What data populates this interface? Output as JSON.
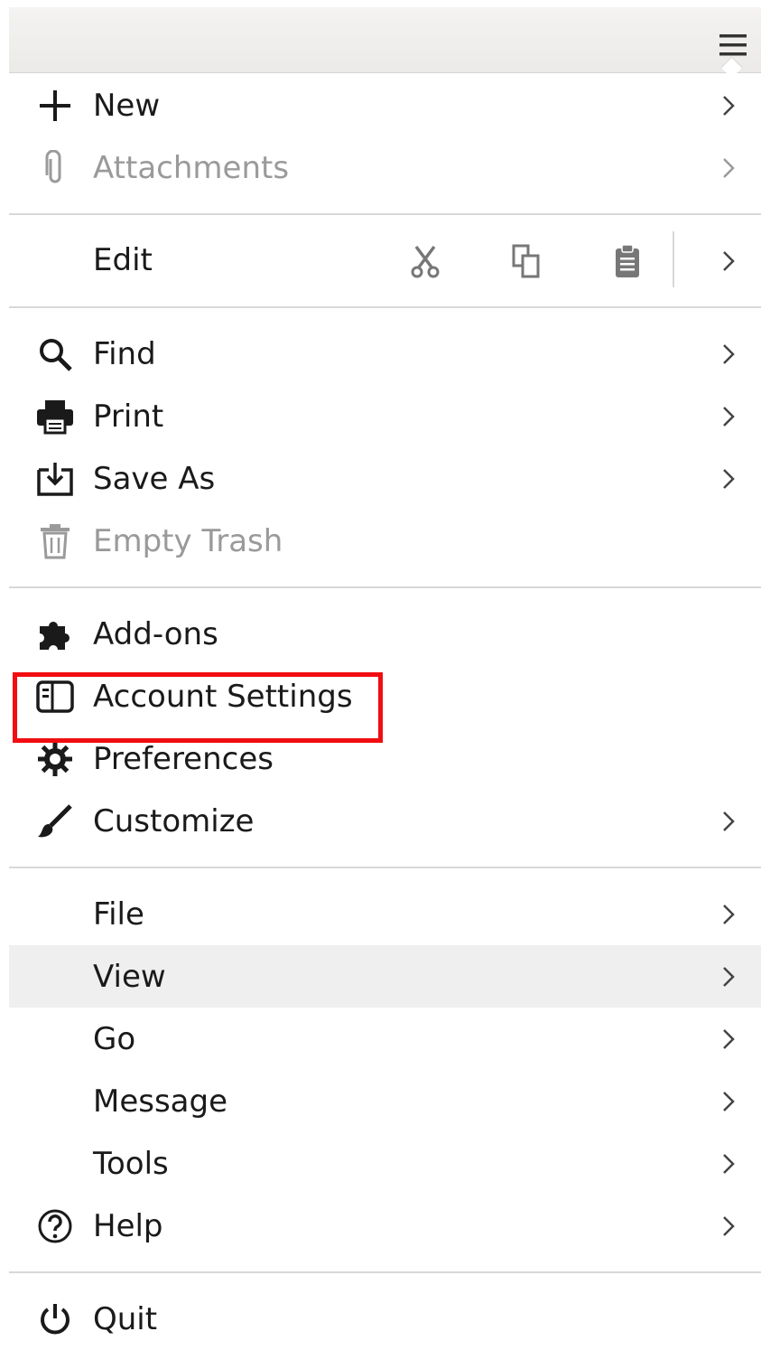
{
  "menu": {
    "group1": [
      {
        "label": "New",
        "icon": "plus-icon",
        "submenu": true,
        "disabled": false
      },
      {
        "label": "Attachments",
        "icon": "paperclip-icon",
        "submenu": true,
        "disabled": true
      }
    ],
    "edit": {
      "label": "Edit",
      "buttons": [
        "cut-icon",
        "copy-icon",
        "paste-icon"
      ]
    },
    "group2": [
      {
        "label": "Find",
        "icon": "search-icon"
      },
      {
        "label": "Print",
        "icon": "printer-icon"
      },
      {
        "label": "Save As",
        "icon": "save-as-icon"
      },
      {
        "label": "Empty Trash",
        "icon": "trash-icon"
      }
    ],
    "group3": [
      {
        "label": "Add-ons",
        "icon": "puzzle-icon"
      },
      {
        "label": "Account Settings",
        "icon": "account-settings-icon"
      },
      {
        "label": "Preferences",
        "icon": "gear-icon"
      },
      {
        "label": "Customize",
        "icon": "brush-icon"
      }
    ],
    "group4": [
      {
        "label": "File"
      },
      {
        "label": "View"
      },
      {
        "label": "Go"
      },
      {
        "label": "Message"
      },
      {
        "label": "Tools"
      },
      {
        "label": "Help",
        "icon": "help-icon"
      }
    ],
    "group5": [
      {
        "label": "Quit",
        "icon": "power-icon"
      }
    ]
  },
  "colors": {
    "highlight_box": "#f10d10",
    "hover_row": "#efefef",
    "disabled_text": "#9a9a9a"
  }
}
